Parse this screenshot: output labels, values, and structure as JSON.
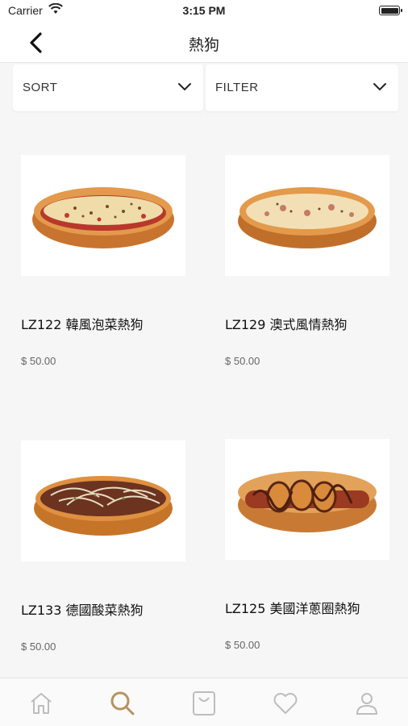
{
  "status": {
    "carrier": "Carrier",
    "time": "3:15 PM"
  },
  "nav": {
    "title": "熱狗"
  },
  "controls": {
    "sort_label": "SORT",
    "filter_label": "FILTER"
  },
  "products": [
    {
      "name": "LZ122 韓風泡菜熱狗",
      "price": "$ 50.00",
      "topping": "kimchi-cheese"
    },
    {
      "name": "LZ129 澳式風情熱狗",
      "price": "$ 50.00",
      "topping": "bacon-cheese"
    },
    {
      "name": "LZ133 德國酸菜熱狗",
      "price": "$ 50.00",
      "topping": "sauerkraut"
    },
    {
      "name": "LZ125 美國洋蔥圈熱狗",
      "price": "$ 50.00",
      "topping": "onion-rings-bbq"
    }
  ],
  "tabs": [
    {
      "icon": "home-icon",
      "active": false
    },
    {
      "icon": "search-icon",
      "active": true
    },
    {
      "icon": "shopping-bag-icon",
      "active": false
    },
    {
      "icon": "heart-icon",
      "active": false
    },
    {
      "icon": "profile-icon",
      "active": false
    }
  ],
  "colors": {
    "accent": "#b8925f",
    "inactive_icon": "#bdbdbd",
    "bun": "#d98a3a"
  }
}
